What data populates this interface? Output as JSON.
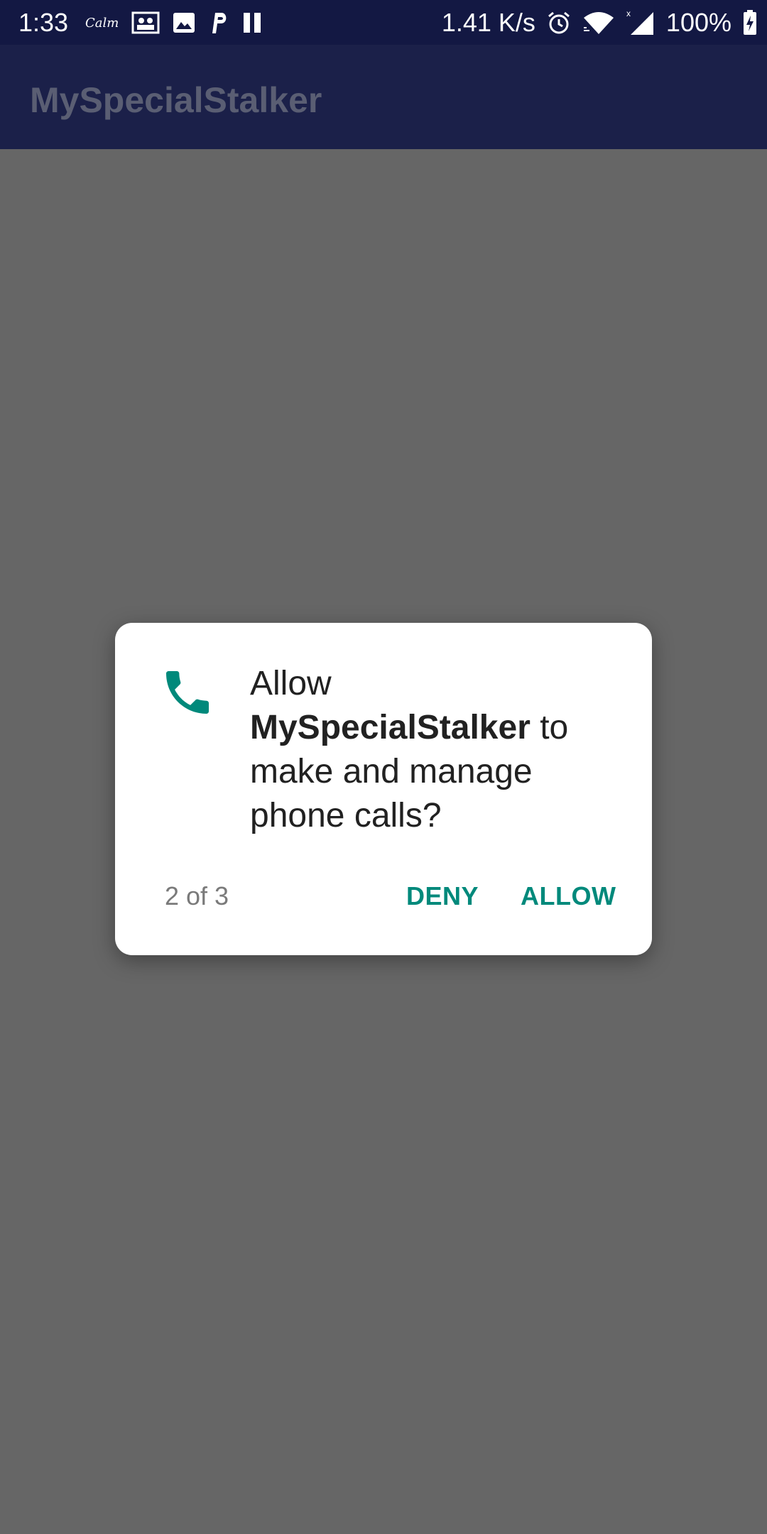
{
  "status_bar": {
    "time": "1:33",
    "notification_calm": "Calm",
    "net_speed": "1.41 K/s",
    "battery_percent": "100%",
    "icons": [
      "calm-icon",
      "contacts-card-icon",
      "image-icon",
      "parking-p-icon",
      "pause-icon",
      "alarm-icon",
      "wifi-icon",
      "cell-signal-icon",
      "battery-charging-icon"
    ]
  },
  "app_bar": {
    "title": "MySpecialStalker"
  },
  "dialog": {
    "prefix": "Allow ",
    "app_name": "MySpecialStalker",
    "suffix": " to make and manage phone calls?",
    "counter": "2 of 3",
    "deny_label": "DENY",
    "allow_label": "ALLOW",
    "icon": "phone-icon"
  },
  "colors": {
    "status_bar_bg": "#131843",
    "app_bar_bg": "#1b2049",
    "scrim_bg": "#666666",
    "accent": "#00897b"
  }
}
